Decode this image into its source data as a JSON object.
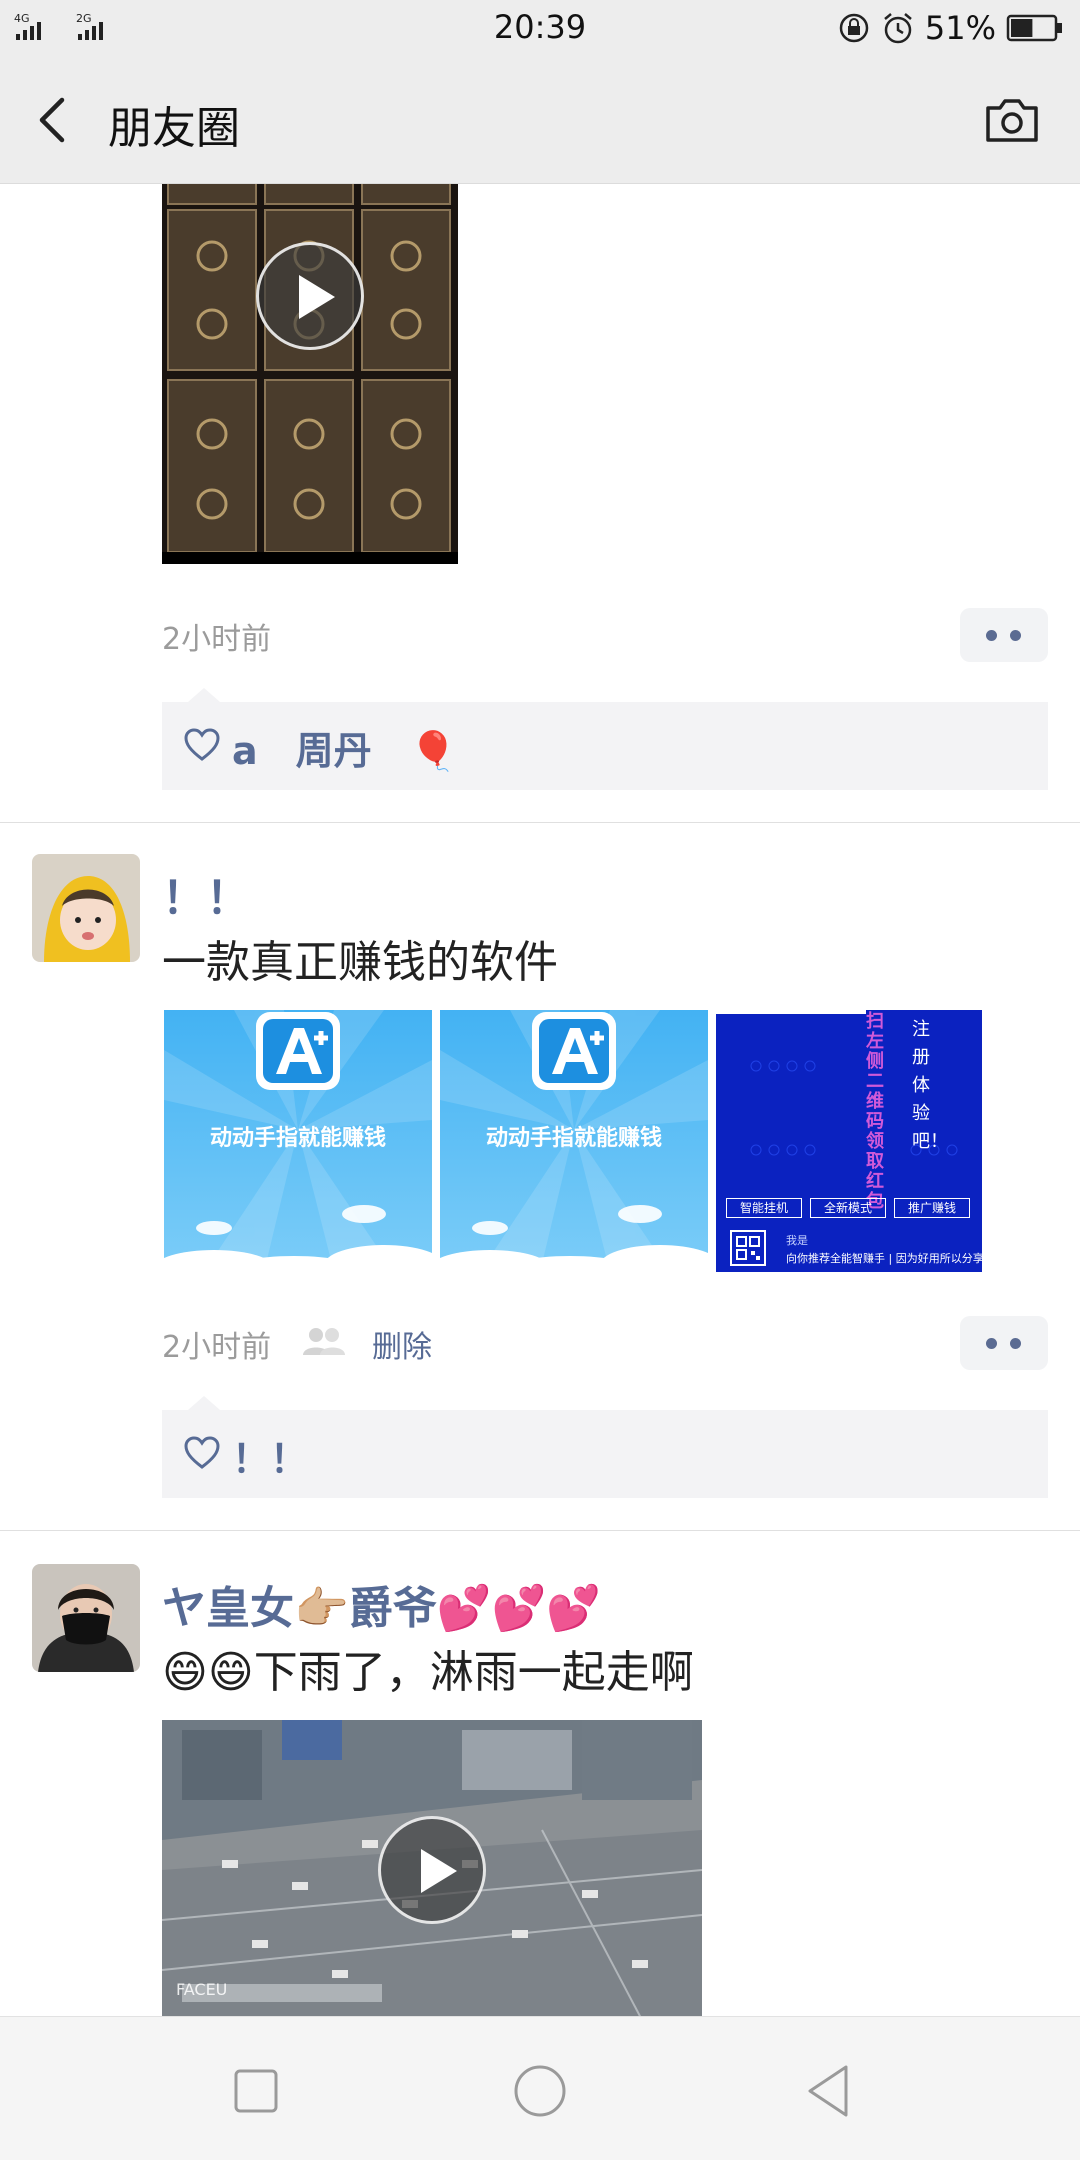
{
  "status_bar": {
    "network_1": "4G",
    "network_2": "2G",
    "time": "20:39",
    "battery_percent": "51%",
    "battery_level": 0.51
  },
  "header": {
    "title": "朋友圈",
    "back_icon": "chevron-left-icon",
    "camera_icon": "camera-icon"
  },
  "posts": [
    {
      "time": "2小时前",
      "media": "video",
      "likes": "a　周丹　🎈"
    },
    {
      "nickname": "！！",
      "text": "一款真正赚钱的软件",
      "images": [
        {
          "caption": "动动手指就能赚钱"
        },
        {
          "caption": "动动手指就能赚钱"
        },
        {
          "vertical_text_1": "扫左侧二维码领取红包",
          "vertical_text_2": "注册体验吧！",
          "buttons": [
            "智能挂机",
            "全新模式",
            "推广赚钱"
          ],
          "footer_line_1": "我是",
          "footer_line_2": "向你推荐全能智赚手 | 因为好用所以分享"
        }
      ],
      "time": "2小时前",
      "delete_label": "删除",
      "likes": "！！"
    },
    {
      "nickname": "ヤ皇女👉🏼爵爷💕💕💕",
      "text": "😄😄下雨了，淋雨一起走啊",
      "media": "video",
      "video_watermark": "FACEU"
    }
  ],
  "nav_keys": [
    "recent-apps-icon",
    "home-icon",
    "back-triangle-icon"
  ]
}
